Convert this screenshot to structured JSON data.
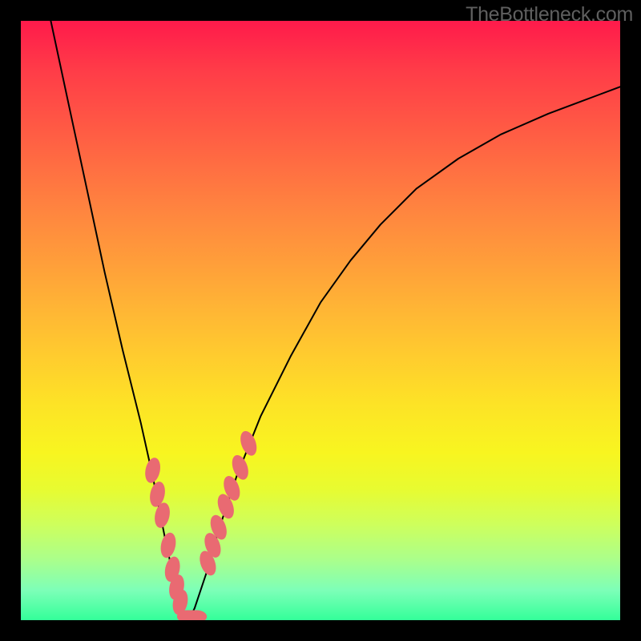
{
  "watermark": "TheBottleneck.com",
  "chart_data": {
    "type": "line",
    "title": "",
    "xlabel": "",
    "ylabel": "",
    "xlim": [
      0,
      100
    ],
    "ylim": [
      0,
      100
    ],
    "series": [
      {
        "name": "curve",
        "x": [
          5,
          8,
          11,
          14,
          17,
          20,
          22,
          24,
          25.5,
          27,
          28,
          29,
          31,
          33,
          36,
          40,
          45,
          50,
          55,
          60,
          66,
          73,
          80,
          88,
          96,
          100
        ],
        "y": [
          100,
          86,
          72,
          58,
          45,
          33,
          24,
          14,
          7,
          2,
          0,
          2,
          8,
          15,
          24,
          34,
          44,
          53,
          60,
          66,
          72,
          77,
          81,
          84.5,
          87.5,
          89
        ]
      },
      {
        "name": "markers-left",
        "x": [
          22.0,
          22.8,
          23.6,
          24.6,
          25.3,
          26.0,
          26.6
        ],
        "y": [
          25.0,
          21.0,
          17.5,
          12.5,
          8.5,
          5.5,
          3.0
        ]
      },
      {
        "name": "markers-right",
        "x": [
          31.2,
          32.0,
          33.0,
          34.2,
          35.2,
          36.6,
          38.0
        ],
        "y": [
          9.5,
          12.5,
          15.5,
          19.0,
          22.0,
          25.5,
          29.5
        ]
      },
      {
        "name": "markers-bottom",
        "x": [
          27.8,
          28.5,
          29.3
        ],
        "y": [
          0.6,
          0.6,
          0.6
        ]
      }
    ],
    "marker_color": "#e96a72",
    "curve_color": "#000000"
  }
}
